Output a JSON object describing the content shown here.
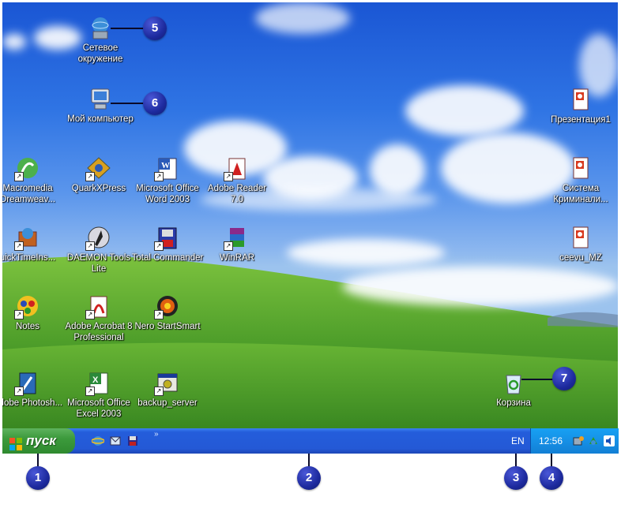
{
  "desktop": {
    "icons": [
      {
        "id": "network",
        "label": "Сетевое окружение",
        "icon": "network-places-icon"
      },
      {
        "id": "mycomputer",
        "label": "Мой компьютер",
        "icon": "my-computer-icon"
      },
      {
        "id": "dreamweaver",
        "label": "Macromedia Dreamweav...",
        "icon": "dreamweaver-icon"
      },
      {
        "id": "quarkxpress",
        "label": "QuarkXPress",
        "icon": "quarkxpress-icon"
      },
      {
        "id": "word",
        "label": "Microsoft Office Word 2003",
        "icon": "word-icon"
      },
      {
        "id": "adobereader",
        "label": "Adobe Reader 7.0",
        "icon": "adobe-reader-icon"
      },
      {
        "id": "quicktime",
        "label": "uickTimeIns...",
        "icon": "quicktime-icon"
      },
      {
        "id": "daemon",
        "label": "DAEMON Tools Lite",
        "icon": "daemon-tools-icon"
      },
      {
        "id": "totalcmd",
        "label": "Total Commander",
        "icon": "total-commander-icon"
      },
      {
        "id": "winrar",
        "label": "WinRAR",
        "icon": "winrar-icon"
      },
      {
        "id": "notes",
        "label": "Notes",
        "icon": "notes-icon"
      },
      {
        "id": "acrobat",
        "label": "Adobe Acrobat 8 Professional",
        "icon": "acrobat-icon"
      },
      {
        "id": "nero",
        "label": "Nero StartSmart",
        "icon": "nero-icon"
      },
      {
        "id": "photoshop",
        "label": "Adobe Photosh...",
        "icon": "photoshop-icon"
      },
      {
        "id": "excel",
        "label": "Microsoft Office Excel 2003",
        "icon": "excel-icon"
      },
      {
        "id": "backup",
        "label": "backup_server",
        "icon": "backup-server-icon"
      },
      {
        "id": "pres1",
        "label": "Презентация1",
        "icon": "powerpoint-file-icon"
      },
      {
        "id": "pres2",
        "label": "Система Криминали...",
        "icon": "powerpoint-file-icon"
      },
      {
        "id": "pres3",
        "label": "ceevu_MZ",
        "icon": "powerpoint-file-icon"
      },
      {
        "id": "recycle",
        "label": "Корзина",
        "icon": "recycle-bin-icon"
      }
    ]
  },
  "taskbar": {
    "start_label": "пуск",
    "quick_launch": [
      "internet-explorer-icon",
      "outlook-express-icon",
      "save-icon"
    ],
    "chevron": "»",
    "language": "EN",
    "clock": "12:56",
    "tray_icons": [
      "tray-app-icon",
      "network-tray-icon",
      "volume-tray-icon"
    ]
  },
  "callouts": {
    "c1": "1",
    "c2": "2",
    "c3": "3",
    "c4": "4",
    "c5": "5",
    "c6": "6",
    "c7": "7"
  },
  "colors": {
    "callout": "#1d2a9e",
    "taskbar": "#245ddb",
    "start_button": "#3c9a3c",
    "tray": "#1690e6"
  }
}
